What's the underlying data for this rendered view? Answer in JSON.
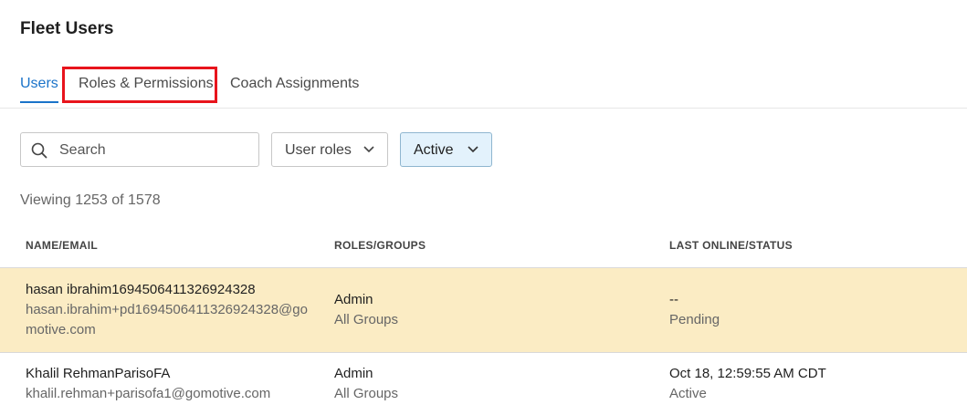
{
  "page": {
    "title": "Fleet Users"
  },
  "tabs": [
    {
      "label": "Users",
      "active": true
    },
    {
      "label": "Roles & Permissions",
      "active": false
    },
    {
      "label": "Coach Assignments",
      "active": false
    }
  ],
  "filters": {
    "search_placeholder": "Search",
    "search_value": "",
    "search_icon": "search-icon",
    "roles_label": "User roles",
    "status_label": "Active",
    "chevron_icon": "chevron-down-icon"
  },
  "summary": {
    "viewing": "Viewing 1253 of 1578"
  },
  "table": {
    "columns": [
      "NAME/EMAIL",
      "ROLES/GROUPS",
      "LAST ONLINE/STATUS"
    ],
    "rows": [
      {
        "name": "hasan ibrahim1694506411326924328",
        "email": "hasan.ibrahim+pd1694506411326924328@gomotive.com",
        "role": "Admin",
        "groups": "All Groups",
        "last_online": "--",
        "status": "Pending"
      },
      {
        "name": "Khalil RehmanParisoFA",
        "email": "khalil.rehman+parisofa1@gomotive.com",
        "role": "Admin",
        "groups": "All Groups",
        "last_online": "Oct 18, 12:59:55 AM CDT",
        "status": "Active"
      }
    ]
  },
  "colors": {
    "accent": "#1a73c9",
    "highlight_row": "#fbecc4",
    "annotation": "#e8141c",
    "status_filter_bg": "#e3f2fc"
  }
}
